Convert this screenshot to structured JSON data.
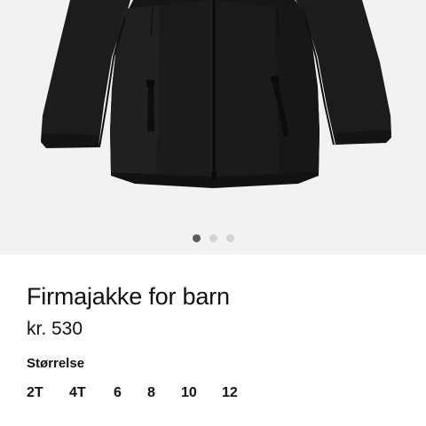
{
  "product": {
    "title": "Firmajakke for barn",
    "price": "kr. 530"
  },
  "gallery": {
    "image_icon": "black-softshell-jacket-photo",
    "image_count": 3,
    "active_index": 0
  },
  "size_selector": {
    "label": "Størrelse",
    "options": [
      "2T",
      "4T",
      "6",
      "8",
      "10",
      "12"
    ]
  },
  "colors": {
    "gallery_background": "#f2f2f2",
    "jacket": "#1b1b1b",
    "dot_active": "#5a5a5a",
    "dot_inactive": "#d4d4d4",
    "text": "#111111"
  }
}
